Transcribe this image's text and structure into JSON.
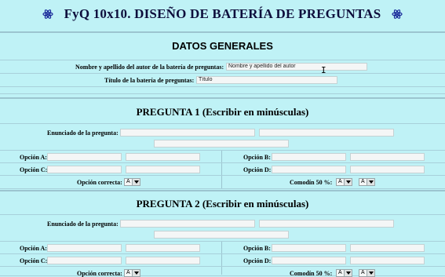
{
  "header": {
    "title": "FyQ 10x10. DISEÑO DE BATERÍA DE PREGUNTAS"
  },
  "general": {
    "heading": "DATOS GENERALES",
    "author_label": "Nombre y apellido del autor de la batería de preguntas:",
    "author_value": "Nombre y apellido del autor",
    "title_label": "Título de la batería de preguntas:",
    "title_value": "Título"
  },
  "questions": [
    {
      "heading": "PREGUNTA 1 (Escribir en minúsculas)",
      "statement_label": "Enunciado de la pregunta:",
      "option_a_label": "Opción A:",
      "option_b_label": "Opción B:",
      "option_c_label": "Opción C:",
      "option_d_label": "Opción D:",
      "correct_label": "Opción correcta:",
      "correct_value": "A",
      "wildcard_label": "Comodín 50 %:",
      "wildcard_value_1": "A",
      "wildcard_value_2": "A"
    },
    {
      "heading": "PREGUNTA 2 (Escribir en minúsculas)",
      "statement_label": "Enunciado de la pregunta:",
      "option_a_label": "Opción A:",
      "option_b_label": "Opción B:",
      "option_c_label": "Opción C:",
      "option_d_label": "Opción D:",
      "correct_label": "Opción correcta:",
      "correct_value": "A",
      "wildcard_label": "Comodín 50 %:",
      "wildcard_value_1": "A",
      "wildcard_value_2": "A"
    }
  ],
  "icons": [
    "atom-icon",
    "atom-icon"
  ]
}
